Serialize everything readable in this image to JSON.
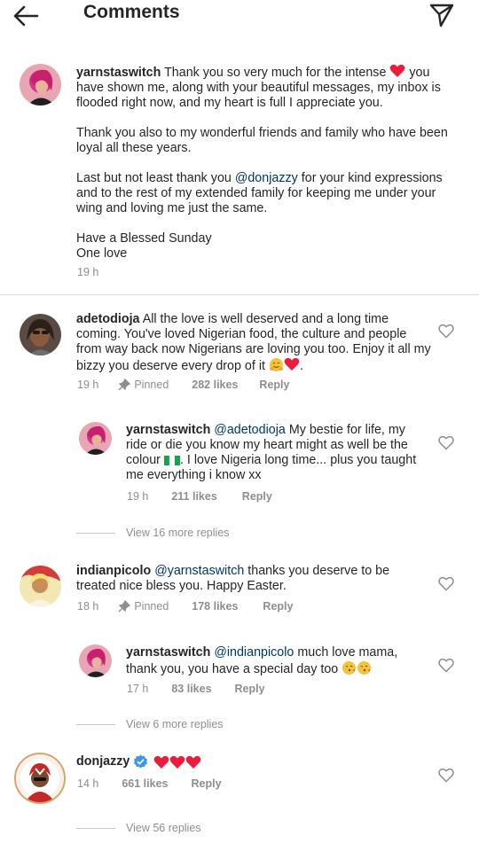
{
  "header": {
    "title": "Comments"
  },
  "caption": {
    "username": "yarnstaswitch",
    "line1": "Thank you so very much  for the intense",
    "line1_tail": "you have shown me, along with your beautiful messages, my inbox is flooded right now, and my heart is full I appreciate you.",
    "para2": "Thank you also to my wonderful friends and family who have been loyal all these years.",
    "para3_pre": "Last but not least thank you",
    "para3_mention": "@donjazzy",
    "para3_post": "for your kind expressions and to the rest of my extended family for keeping me under your wing and loving me just the same.",
    "para4_l1": "Have a Blessed Sunday",
    "para4_l2": "One love",
    "time": "19 h"
  },
  "comments": [
    {
      "username": "adetodioja",
      "text": "All the love is well deserved and a long time coming. You've loved Nigerian  food, the culture and people from way back now Nigerians are loving you too. Enjoy it all my bizzy you deserve every drop of it",
      "time": "19 h",
      "pinned": "Pinned",
      "likes": "282 likes",
      "reply": "Reply",
      "replies": [
        {
          "username": "yarnstaswitch",
          "mention": "@adetodioja",
          "text_pre": "My bestie for life, my ride or die you know my heart might as well be the colour",
          "text_post": ". I love Nigeria long time... plus you taught me everything i know xx",
          "time": "19 h",
          "likes": "211 likes",
          "reply": "Reply"
        }
      ],
      "view_more": "View 16 more replies"
    },
    {
      "username": "indianpicolo",
      "mention": "@yarnstaswitch",
      "text": "thanks you deserve to be treated  nice bless you. Happy Easter.",
      "time": "18 h",
      "pinned": "Pinned",
      "likes": "178 likes",
      "reply": "Reply",
      "replies": [
        {
          "username": "yarnstaswitch",
          "mention": "@indianpicolo",
          "text": "much love mama, thank you, you  have a special day too",
          "time": "17 h",
          "likes": "83 likes",
          "reply": "Reply"
        }
      ],
      "view_more": "View 6 more replies"
    },
    {
      "username": "donjazzy",
      "time": "14 h",
      "likes": "661 likes",
      "reply": "Reply",
      "view_more": "View 56 replies"
    }
  ],
  "colors": {
    "text": "#262626",
    "secondary": "#8e8e8e",
    "mention": "#00376b",
    "heart_red": "#ed1c3c",
    "verified": "#3897f0"
  },
  "icons": [
    "back-arrow-icon",
    "send-icon",
    "heart-icon",
    "pin-icon",
    "verified-badge-icon",
    "red-heart-emoji-icon",
    "nigeria-flag-icon",
    "hugging-face-emoji-icon",
    "kissing-face-emoji-icon"
  ]
}
